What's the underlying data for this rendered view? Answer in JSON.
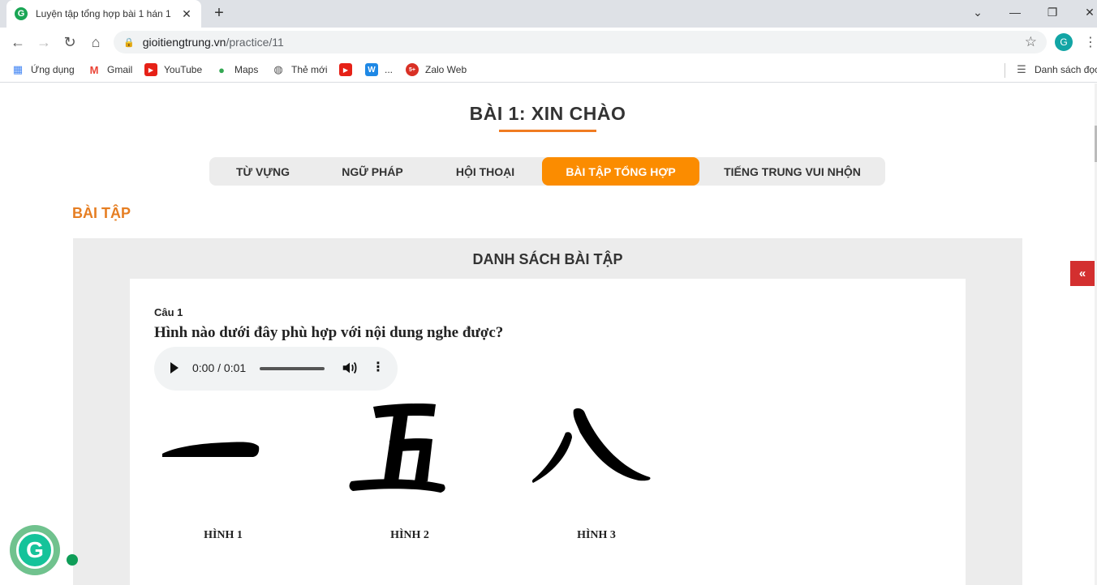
{
  "browser": {
    "tab_title": "Luyện tập tổng hợp bài 1 hán 1",
    "tab_close": "✕",
    "new_tab": "+",
    "url_host": "gioitiengtrung.vn",
    "url_path": "/practice/11",
    "profile_initial": "G",
    "bookmarks": [
      "Ứng dụng",
      "Gmail",
      "YouTube",
      "Maps",
      "Thẻ mới",
      "...",
      "Zalo Web"
    ],
    "reading_list": "Danh sách đọc"
  },
  "page": {
    "lesson_title": "BÀI 1: XIN CHÀO",
    "tabs": [
      "TỪ VỰNG",
      "NGỮ PHÁP",
      "HỘI THOẠI",
      "BÀI TẬP TỔNG HỢP",
      "TIẾNG TRUNG VUI NHỘN"
    ],
    "active_tab": "BÀI TẬP TỔNG HỢP",
    "section_label": "BÀI TẬP",
    "panel_title": "DANH SÁCH BÀI TẬP",
    "question": {
      "number": "Câu 1",
      "text": "Hình nào dưới đây phù hợp với nội dung nghe được?",
      "audio_time": "0:00 / 0:01",
      "options": [
        {
          "label": "HÌNH 1",
          "character": "一"
        },
        {
          "label": "HÌNH 2",
          "character": "五"
        },
        {
          "label": "HÌNH 3",
          "character": "八"
        }
      ]
    },
    "side_toggle": "«"
  },
  "colors": {
    "accent_orange": "#fb8c00",
    "section_orange": "#e67e22",
    "toggle_red": "#d32f2f"
  }
}
